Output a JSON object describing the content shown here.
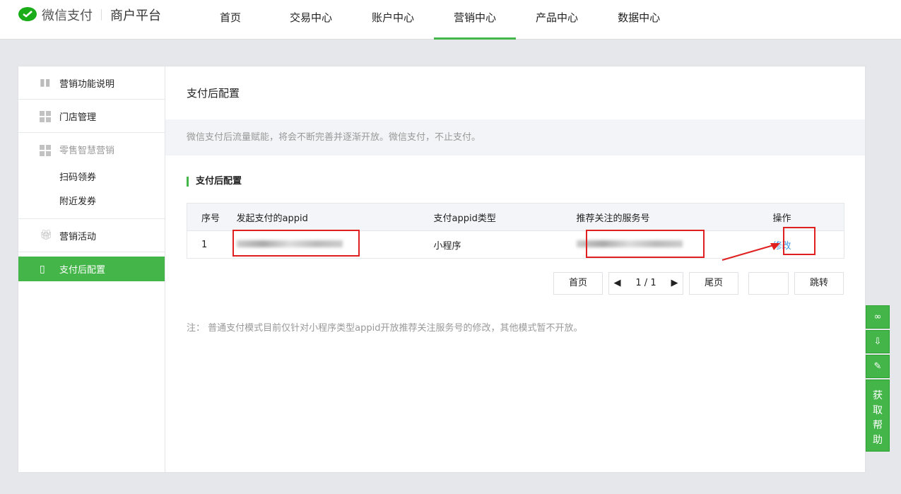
{
  "header": {
    "brand": "微信支付",
    "platform": "商户平台",
    "nav": [
      "首页",
      "交易中心",
      "账户中心",
      "营销中心",
      "产品中心",
      "数据中心"
    ]
  },
  "sidebar": {
    "items": [
      "营销功能说明",
      "门店管理",
      "零售智慧营销",
      "扫码领券",
      "附近发券",
      "营销活动",
      "支付后配置"
    ]
  },
  "main": {
    "title": "支付后配置",
    "notice": "微信支付后流量赋能，将会不断完善并逐渐开放。微信支付，不止支付。",
    "section": "支付后配置",
    "table": {
      "headers": [
        "序号",
        "发起支付的appid",
        "支付appid类型",
        "推荐关注的服务号",
        "操作"
      ],
      "rows": [
        {
          "index": "1",
          "type": "小程序",
          "action": "修改"
        }
      ]
    },
    "pager": {
      "first": "首页",
      "page": "1 / 1",
      "last": "尾页",
      "jump": "跳转"
    },
    "note": "注： 普通支付模式目前仅针对小程序类型appid开放推荐关注服务号的修改，其他模式暂不开放。"
  },
  "float": {
    "help": "获取帮助"
  },
  "colors": {
    "accent": "#44b549",
    "link": "#459ae9",
    "highlight": "#e02020"
  }
}
